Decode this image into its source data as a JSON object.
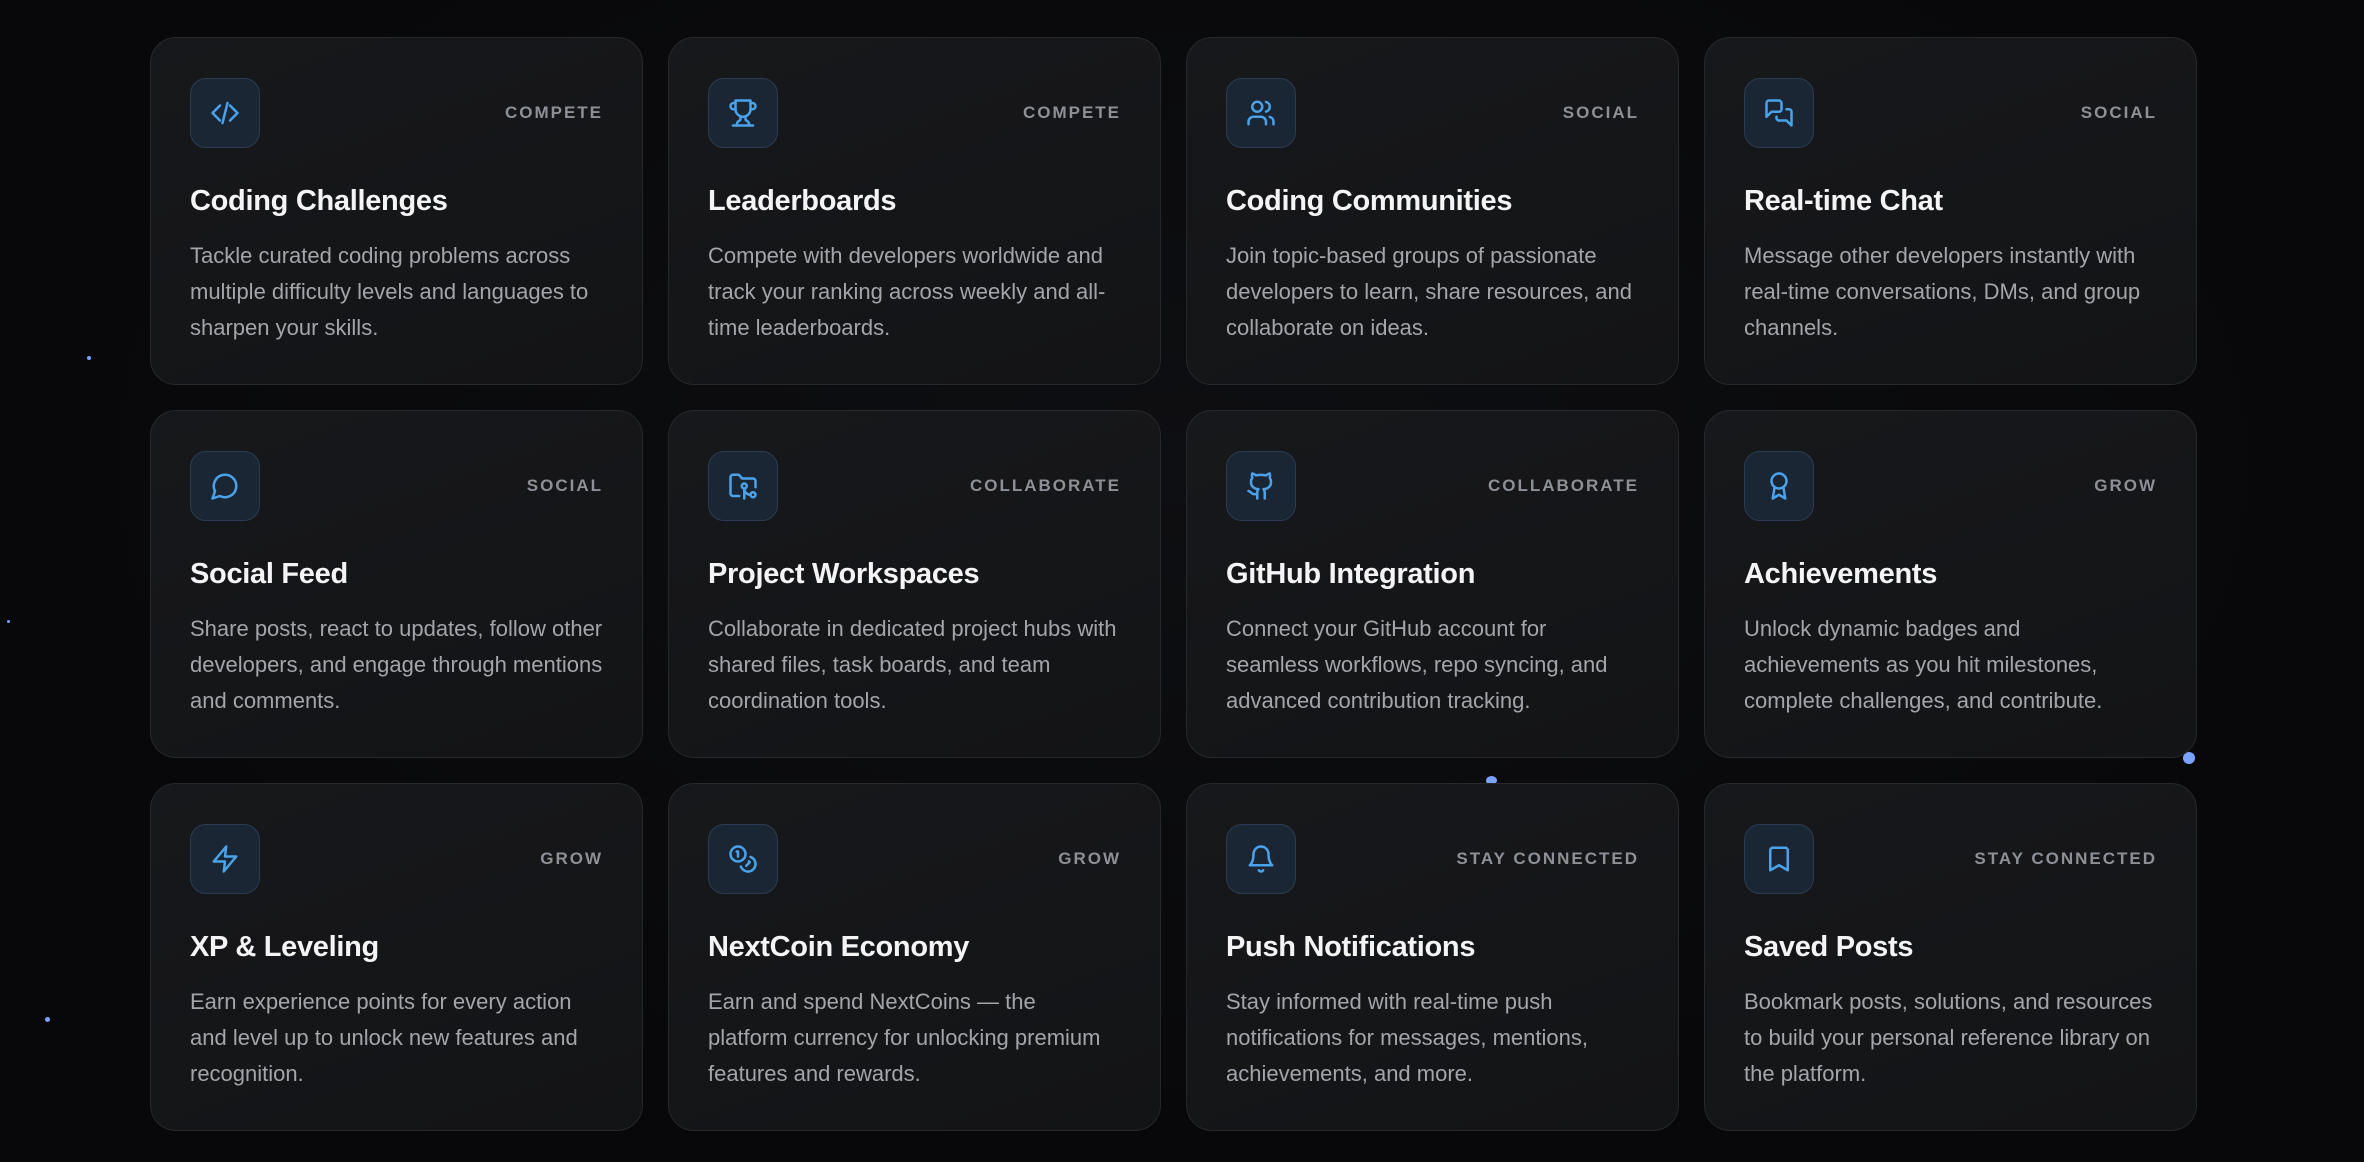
{
  "features": [
    {
      "tag": "COMPETE",
      "title": "Coding Challenges",
      "description": "Tackle curated coding problems across multiple difficulty levels and languages to sharpen your skills.",
      "icon": "code-icon"
    },
    {
      "tag": "COMPETE",
      "title": "Leaderboards",
      "description": "Compete with developers worldwide and track your ranking across weekly and all-time leaderboards.",
      "icon": "trophy-icon"
    },
    {
      "tag": "SOCIAL",
      "title": "Coding Communities",
      "description": "Join topic-based groups of passionate developers to learn, share resources, and collaborate on ideas.",
      "icon": "users-icon"
    },
    {
      "tag": "SOCIAL",
      "title": "Real-time Chat",
      "description": "Message other developers instantly with real-time conversations, DMs, and group channels.",
      "icon": "chat-icon"
    },
    {
      "tag": "SOCIAL",
      "title": "Social Feed",
      "description": "Share posts, react to updates, follow other developers, and engage through mentions and comments.",
      "icon": "message-circle-icon"
    },
    {
      "tag": "COLLABORATE",
      "title": "Project Workspaces",
      "description": "Collaborate in dedicated project hubs with shared files, task boards, and team coordination tools.",
      "icon": "folder-git-icon"
    },
    {
      "tag": "COLLABORATE",
      "title": "GitHub Integration",
      "description": "Connect your GitHub account for seamless workflows, repo syncing, and advanced contribution tracking.",
      "icon": "github-icon"
    },
    {
      "tag": "GROW",
      "title": "Achievements",
      "description": "Unlock dynamic badges and achievements as you hit milestones, complete challenges, and contribute.",
      "icon": "award-icon"
    },
    {
      "tag": "GROW",
      "title": "XP & Leveling",
      "description": "Earn experience points for every action and level up to unlock new features and recognition.",
      "icon": "zap-icon"
    },
    {
      "tag": "GROW",
      "title": "NextCoin Economy",
      "description": "Earn and spend NextCoins — the platform currency for unlocking premium features and rewards.",
      "icon": "coins-icon"
    },
    {
      "tag": "STAY CONNECTED",
      "title": "Push Notifications",
      "description": "Stay informed with real-time push notifications for messages, mentions, achievements, and more.",
      "icon": "bell-icon"
    },
    {
      "tag": "STAY CONNECTED",
      "title": "Saved Posts",
      "description": "Bookmark posts, solutions, and resources to build your personal reference library on the platform.",
      "icon": "bookmark-icon"
    }
  ],
  "colors": {
    "background": "#09090b",
    "card": "#151618",
    "accent": "#4aa3ea",
    "title": "#f4f4f5",
    "text": "#a3a5aa",
    "tag": "#8d9096"
  }
}
